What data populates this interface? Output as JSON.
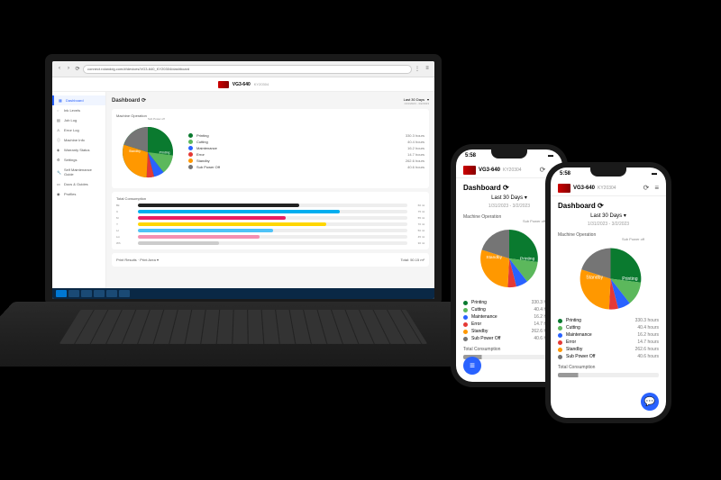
{
  "browser": {
    "url": "connect.rolanddg.com/#/devices/VG3-640_KY20304/dashboard"
  },
  "device": {
    "model": "VG3-640",
    "serial": "KY20304"
  },
  "sidebar": {
    "items": [
      {
        "label": "Dashboard",
        "icon": "grid"
      },
      {
        "label": "Ink Levels",
        "icon": "droplet"
      },
      {
        "label": "Job Log",
        "icon": "list"
      },
      {
        "label": "Error Log",
        "icon": "alert"
      },
      {
        "label": "Machine Info",
        "icon": "info"
      },
      {
        "label": "Warranty Status",
        "icon": "shield"
      },
      {
        "label": "Settings",
        "icon": "gear"
      },
      {
        "label": "Self Maintenance Guide",
        "icon": "wrench"
      },
      {
        "label": "Docs & Guides",
        "icon": "book"
      },
      {
        "label": "Profiles",
        "icon": "user"
      }
    ]
  },
  "dashboard": {
    "title": "Dashboard",
    "period": {
      "label": "Last 30 Days",
      "range": "1/31/2023 - 3/2/2023"
    }
  },
  "machine_operation": {
    "title": "Machine Operation",
    "top_label": "Sub Power off",
    "legend": [
      {
        "name": "Printing",
        "value": "330.3 hours",
        "color": "#0a7a2f"
      },
      {
        "name": "Cutting",
        "value": "40.4 hours",
        "color": "#5cb85c"
      },
      {
        "name": "Maintenance",
        "value": "16.2 hours",
        "color": "#2962ff"
      },
      {
        "name": "Error",
        "value": "14.7 hours",
        "color": "#e53935"
      },
      {
        "name": "Standby",
        "value": "262.6 hours",
        "color": "#ff9800"
      },
      {
        "name": "Sub Power Off",
        "value": "40.6 hours",
        "color": "#757575"
      }
    ]
  },
  "total_consumption": {
    "title": "Total Consumption",
    "bars": [
      {
        "label": "Bk",
        "color": "#222",
        "pct": 60,
        "val": "60 ml"
      },
      {
        "label": "C",
        "color": "#00aeef",
        "pct": 75,
        "val": "75 ml"
      },
      {
        "label": "M",
        "color": "#e91e63",
        "pct": 55,
        "val": "55 ml"
      },
      {
        "label": "Y",
        "color": "#ffd600",
        "pct": 70,
        "val": "70 ml"
      },
      {
        "label": "Lc",
        "color": "#4fc3f7",
        "pct": 50,
        "val": "50 ml"
      },
      {
        "label": "Lm",
        "color": "#f48fb1",
        "pct": 45,
        "val": "45 ml"
      },
      {
        "label": "Wh",
        "color": "#ccc",
        "pct": 30,
        "val": "30 ml"
      }
    ]
  },
  "print_results": {
    "title": "Print Results",
    "subtitle": "Print Area",
    "total_label": "Total: 50.15 m²"
  },
  "phone": {
    "time": "5:58"
  },
  "chart_data": {
    "type": "pie",
    "title": "Machine Operation",
    "series": [
      {
        "name": "hours",
        "values": [
          330.3,
          40.4,
          16.2,
          14.7,
          262.6,
          40.6
        ]
      }
    ],
    "categories": [
      "Printing",
      "Cutting",
      "Maintenance",
      "Error",
      "Standby",
      "Sub Power Off"
    ],
    "colors": [
      "#0a7a2f",
      "#5cb85c",
      "#2962ff",
      "#e53935",
      "#ff9800",
      "#757575"
    ]
  }
}
